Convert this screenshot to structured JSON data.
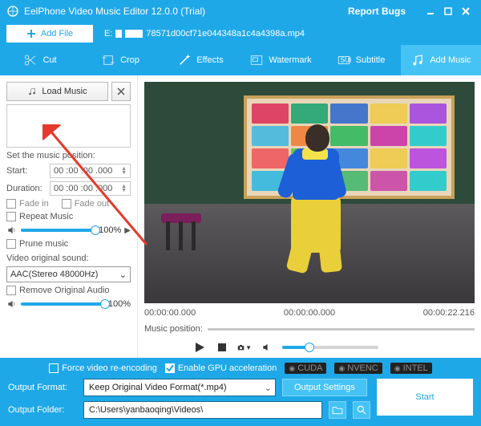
{
  "titlebar": {
    "title": "EelPhone Video Music Editor 12.0.0 (Trial)",
    "report": "Report Bugs"
  },
  "filebar": {
    "add_file": "Add File",
    "file_prefix": "E:",
    "file_name": "78571d00cf71e044348a1c4a4398a.mp4"
  },
  "tabs": {
    "cut": "Cut",
    "crop": "Crop",
    "effects": "Effects",
    "watermark": "Watermark",
    "subtitle": "Subtitle",
    "addmusic": "Add Music"
  },
  "left": {
    "load_music": "Load Music",
    "set_pos": "Set the music position:",
    "start": "Start:",
    "start_val": "00 :00 :00 .000",
    "duration": "Duration:",
    "duration_val": "00 :00 :00 .000",
    "fadein": "Fade in",
    "fadeout": "Fade out",
    "repeat": "Repeat Music",
    "vol1": "100%",
    "play_icon": "▶",
    "prune": "Prune music",
    "orig_label": "Video original sound:",
    "orig_val": "AAC(Stereo 48000Hz)",
    "remove_audio": "Remove Original Audio",
    "vol2": "100%"
  },
  "timeline": {
    "start": "00:00:00.000",
    "mid": "00:00:00.000",
    "end": "00:00:22.216"
  },
  "music_pos": "Music position:",
  "footer": {
    "force": "Force video re-encoding",
    "gpu": "Enable GPU acceleration",
    "b1": "CUDA",
    "b2": "NVENC",
    "b3": "INTEL",
    "outfmt_lbl": "Output Format:",
    "outfmt_val": "Keep Original Video Format(*.mp4)",
    "out_settings": "Output Settings",
    "outfolder_lbl": "Output Folder:",
    "outfolder_val": "C:\\Users\\yanbaoqing\\Videos\\",
    "start": "Start"
  }
}
